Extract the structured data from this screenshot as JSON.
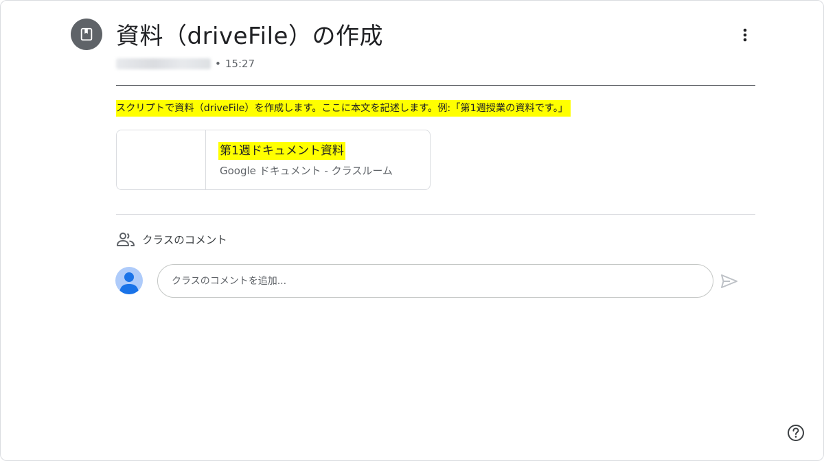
{
  "header": {
    "title": "資料（driveFile）の作成",
    "icon": "bookmark-material-icon",
    "author_name": "■■■ ■■■■■■■■■■",
    "separator": "•",
    "time": "15:27",
    "more_icon": "more-vert-icon"
  },
  "content": {
    "body_text": "スクリプトで資料（driveFile）を作成します。ここに本文を記述します。例:「第1週授業の資料です。」",
    "highlight_color": "#ffff00"
  },
  "attachment": {
    "title": "第1週ドキュメント資料",
    "subtitle": "Google ドキュメント - クラスルーム"
  },
  "comments": {
    "section_label": "クラスのコメント",
    "section_icon": "people-icon",
    "input_placeholder": "クラスのコメントを追加...",
    "send_icon": "send-icon"
  },
  "footer": {
    "help_icon": "help-icon"
  },
  "colors": {
    "accent": "#1a73e8",
    "icon_circle": "#5f6368",
    "avatar_bg": "#aecbfa"
  }
}
